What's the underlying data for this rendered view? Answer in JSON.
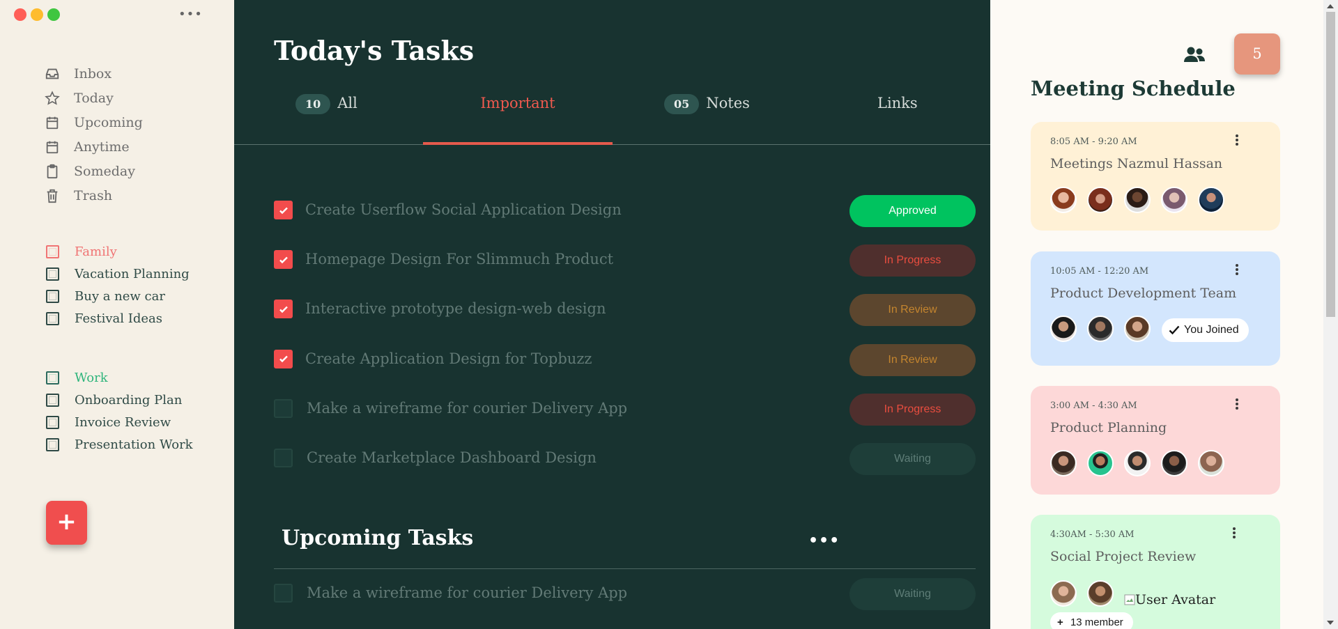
{
  "sidebar": {
    "nav": [
      {
        "label": "Inbox",
        "icon": "inbox-icon"
      },
      {
        "label": "Today",
        "icon": "star-icon"
      },
      {
        "label": "Upcoming",
        "icon": "calendar-icon"
      },
      {
        "label": "Anytime",
        "icon": "calendar-icon"
      },
      {
        "label": "Someday",
        "icon": "clipboard-icon"
      },
      {
        "label": "Trash",
        "icon": "trash-icon"
      }
    ],
    "family": {
      "header": "Family",
      "items": [
        "Vacation Planning",
        "Buy a new car",
        "Festival Ideas"
      ]
    },
    "work": {
      "header": "Work",
      "items": [
        "Onboarding Plan",
        "Invoice Review",
        "Presentation Work"
      ]
    },
    "add_label": "+"
  },
  "main": {
    "title": "Today's Tasks",
    "tabs": [
      {
        "label": "All",
        "count": "10"
      },
      {
        "label": "Important"
      },
      {
        "label": "Notes",
        "count": "05"
      },
      {
        "label": "Links"
      }
    ],
    "tasks": [
      {
        "label": "Create Userflow Social Application Design",
        "checked": true,
        "status": "Approved"
      },
      {
        "label": "Homepage Design For Slimmuch Product",
        "checked": true,
        "status": "In Progress"
      },
      {
        "label": "Interactive prototype design-web design",
        "checked": true,
        "status": "In Review"
      },
      {
        "label": "Create Application Design for Topbuzz",
        "checked": true,
        "status": "In Review"
      },
      {
        "label": "Make a wireframe for courier Delivery App",
        "checked": false,
        "status": "In Progress"
      },
      {
        "label": "Create Marketplace Dashboard Design",
        "checked": false,
        "status": "Waiting"
      }
    ],
    "upcoming": {
      "title": "Upcoming Tasks",
      "tasks": [
        {
          "label": "Make a wireframe for courier Delivery App",
          "checked": false,
          "status": "Waiting"
        }
      ]
    }
  },
  "right": {
    "notification_count": "5",
    "title": "Meeting Schedule",
    "meetings": [
      {
        "time": "8:05 AM - 9:20 AM",
        "title": "Meetings Nazmul Hassan",
        "bg": "#fff1d6"
      },
      {
        "time": "10:05 AM - 12:20 AM",
        "title": "Product Development Team",
        "bg": "#d3e6fd",
        "joined": "You Joined"
      },
      {
        "time": "3:00 AM - 4:30 AM",
        "title": "Product Planning",
        "bg": "#fdd8d8"
      },
      {
        "time": "4:30AM - 5:30 AM",
        "title": "Social Project Review",
        "bg": "#d5fbdd",
        "broken_image_alt": "User Avatar",
        "members": "13 member"
      }
    ]
  },
  "colors": {
    "accent_red": "#f24c4c",
    "approved": "#00c35f",
    "main_bg": "#183330",
    "sidebar_bg": "#f5f0e6"
  }
}
